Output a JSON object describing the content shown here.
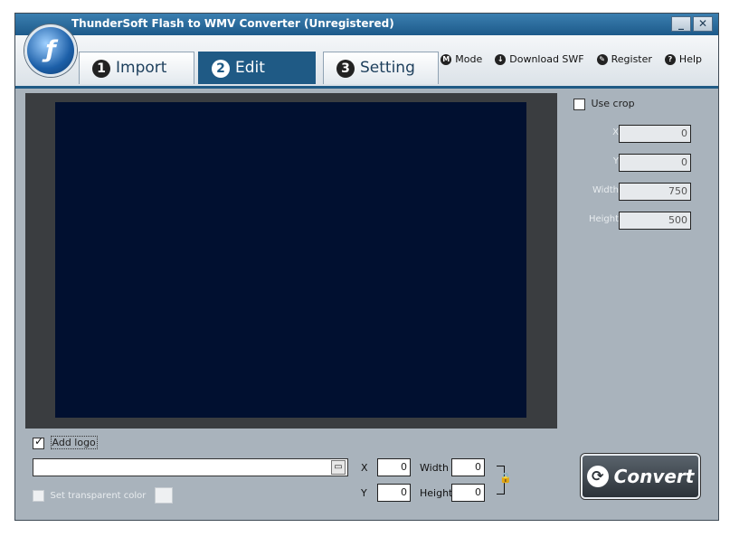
{
  "window": {
    "title": "ThunderSoft Flash to WMV Converter (Unregistered)",
    "minimize": "_",
    "close": "✕"
  },
  "tabs": [
    {
      "num": "1",
      "label": "Import"
    },
    {
      "num": "2",
      "label": "Edit"
    },
    {
      "num": "3",
      "label": "Setting"
    }
  ],
  "menu": {
    "mode": "Mode",
    "mode_icon": "M",
    "download": "Download SWF",
    "download_icon": "↓",
    "register": "Register",
    "register_icon": "✎",
    "help": "Help",
    "help_icon": "?"
  },
  "crop": {
    "use_crop": "Use crop",
    "checked": false,
    "x_label": "X",
    "x": "0",
    "y_label": "Y",
    "y": "0",
    "width_label": "Width",
    "width": "750",
    "height_label": "Height",
    "height": "500"
  },
  "logo": {
    "add_logo": "Add logo",
    "checked": true,
    "path": "",
    "transparent_label": "Set transparent color",
    "x_label": "X",
    "x": "0",
    "y_label": "Y",
    "y": "0",
    "width_label": "Width",
    "width": "0",
    "height_label": "Height",
    "height": "0"
  },
  "convert_button": "Convert",
  "colors": {
    "accent": "#1f5a85",
    "video_bg": "#011030",
    "panel_bg": "#a9b3bc"
  }
}
